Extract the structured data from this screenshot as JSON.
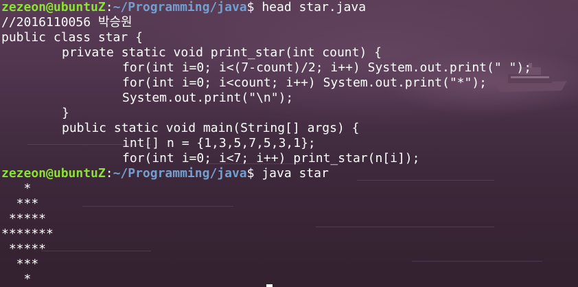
{
  "terminal": {
    "prompt": {
      "user_host": "zezeon@ubuntuZ",
      "sep": ":",
      "path": "~/Programming/java",
      "symbol": "$ "
    },
    "commands": {
      "head": "head star.java",
      "run": "java star"
    },
    "source_lines": [
      "//2016110056 박승원",
      "public class star {",
      "private static void print_star(int count) {",
      "for(int i=0; i<(7-count)/2; i++) System.out.print(\" \");",
      "for(int i=0; i<count; i++) System.out.print(\"*\");",
      "System.out.print(\"\\n\");",
      "}",
      "public static void main(String[] args) {",
      "int[] n = {1,3,5,7,5,3,1};",
      "for(int i=0; i<7; i++) print_star(n[i]);"
    ],
    "output_lines": [
      "   *",
      "  ***",
      " *****",
      "*******",
      " *****",
      "  ***",
      "   *"
    ]
  },
  "colors": {
    "prompt_user": "#8ae234",
    "prompt_path": "#729fcf",
    "text": "#ffffff",
    "background": "#3a2434"
  }
}
